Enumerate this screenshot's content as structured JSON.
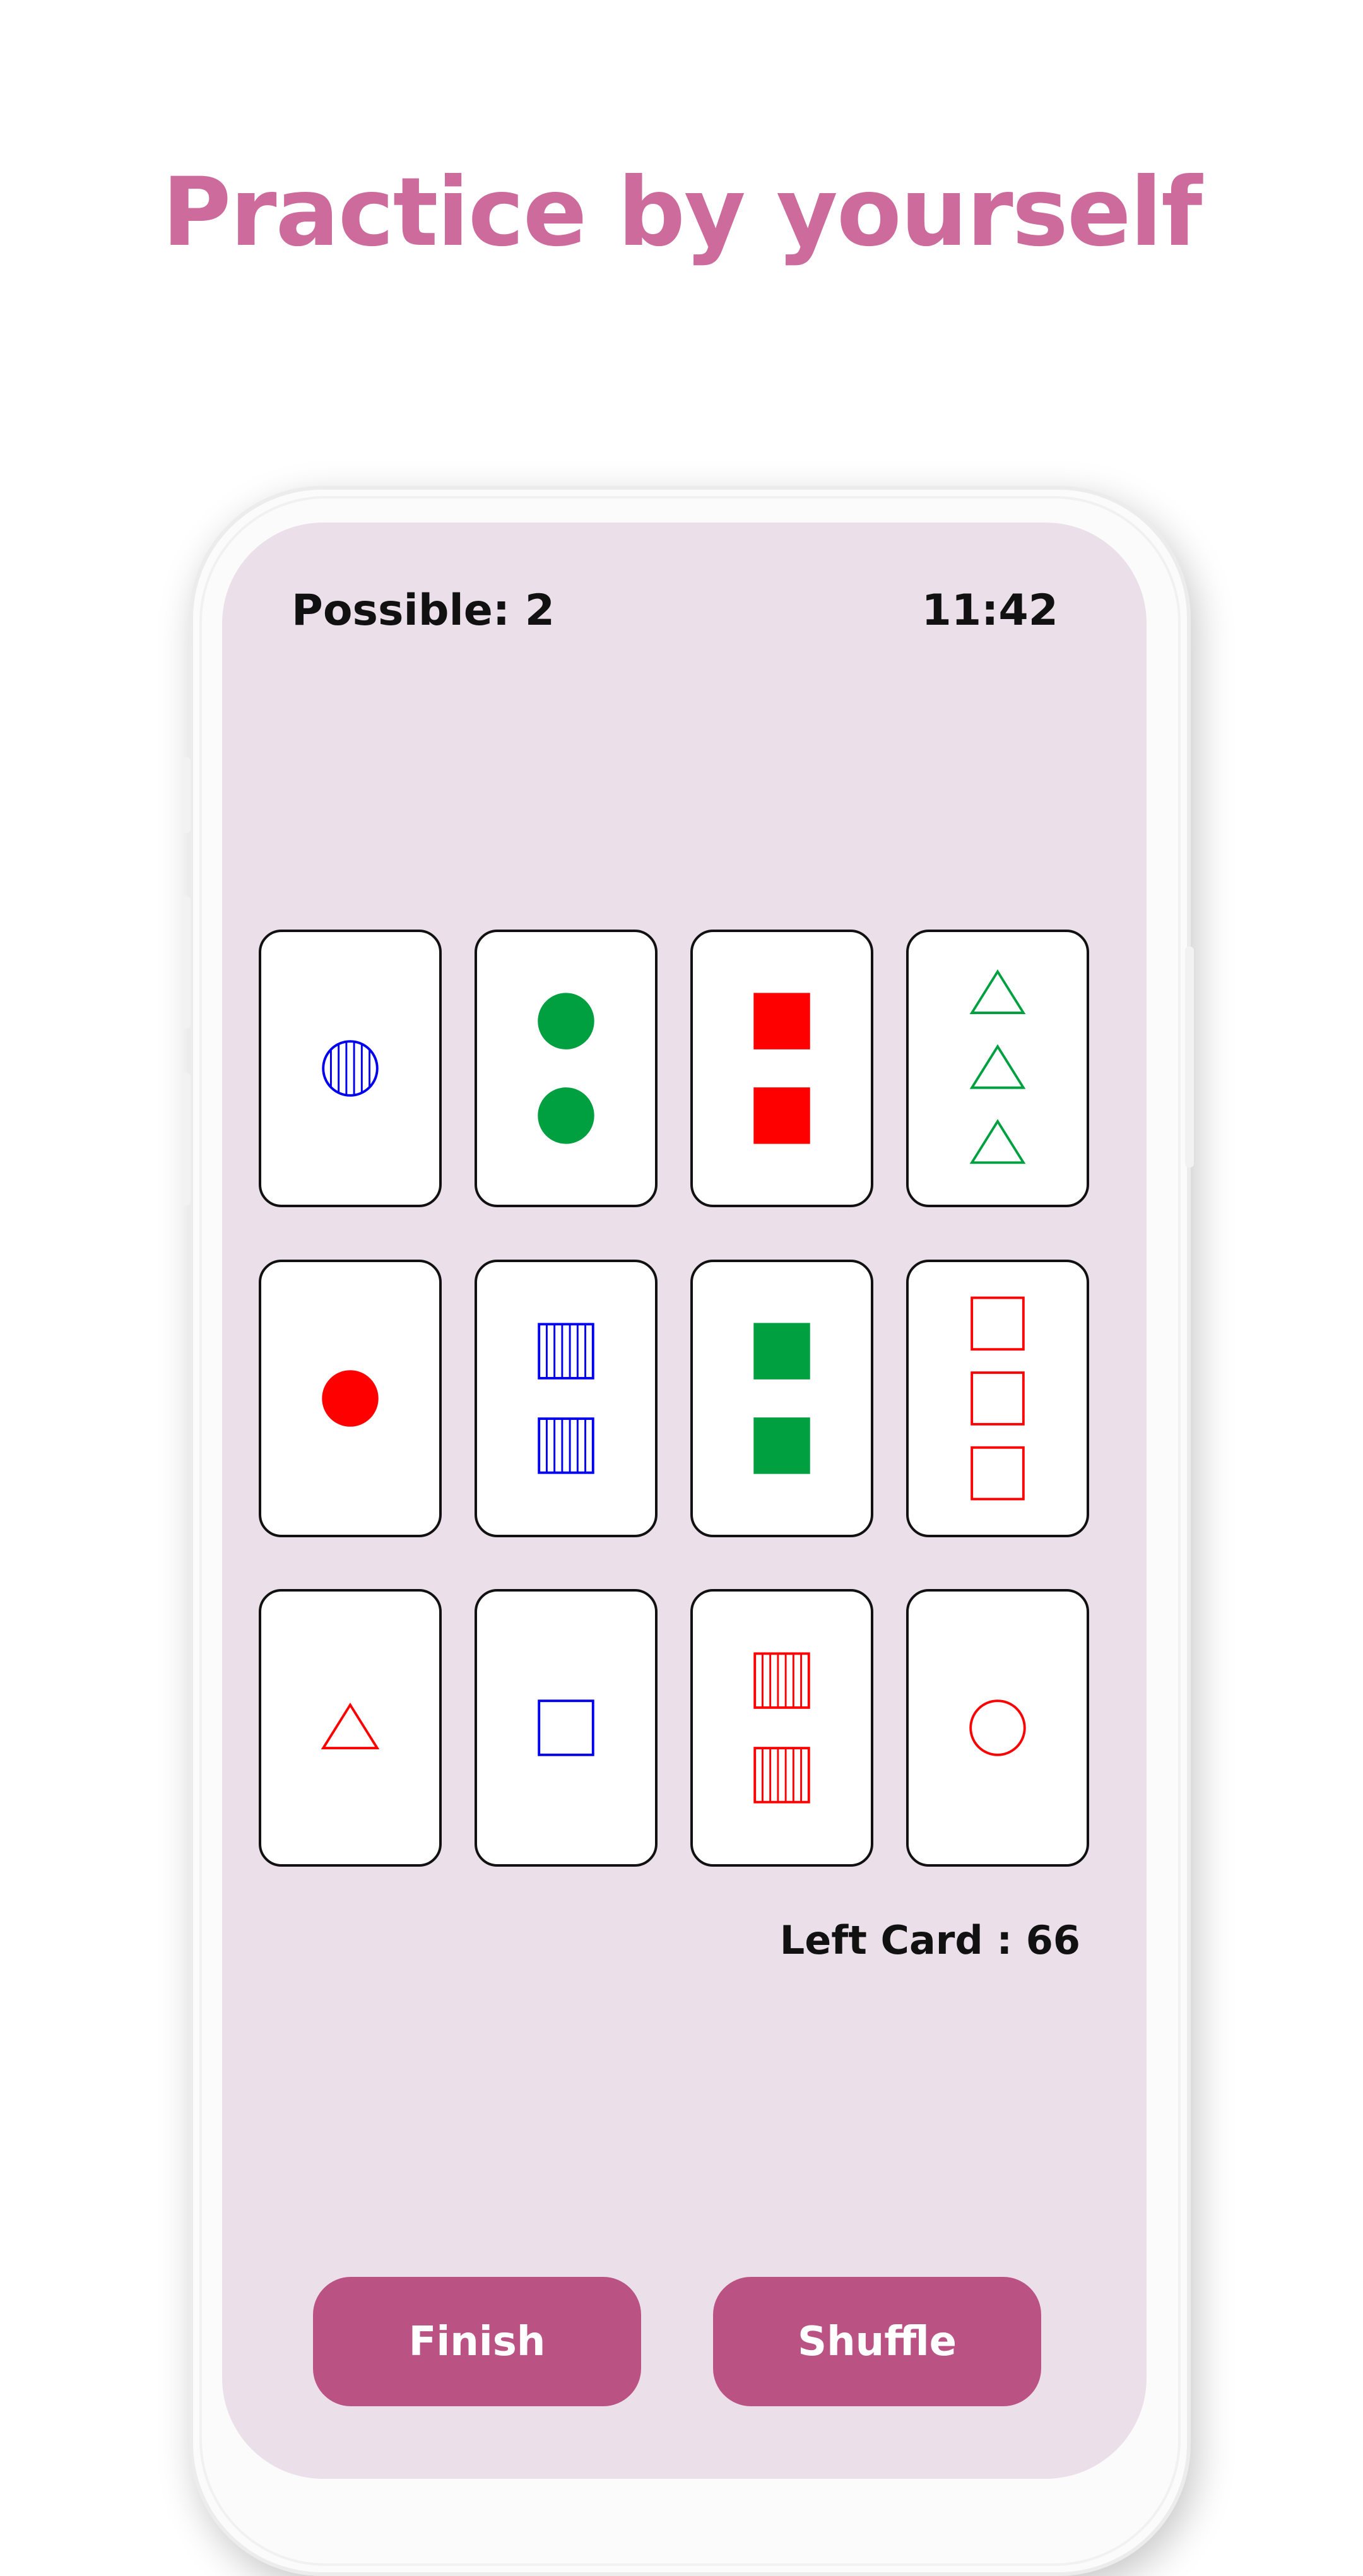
{
  "headline": "Practice by yourself",
  "status": {
    "possible": "Possible: 2",
    "clock": "11:42"
  },
  "colors": {
    "red": "#ff0000",
    "green": "#00a040",
    "blue": "#0000ee",
    "accent": "#ba5384",
    "headline": "#cc6b9c",
    "screen_bg": "#ebe0e9"
  },
  "cards": [
    {
      "count": 1,
      "shape": "circle",
      "fill": "striped",
      "color": "blue"
    },
    {
      "count": 2,
      "shape": "circle",
      "fill": "solid",
      "color": "green"
    },
    {
      "count": 2,
      "shape": "square",
      "fill": "solid",
      "color": "red"
    },
    {
      "count": 3,
      "shape": "triangle",
      "fill": "outline",
      "color": "green"
    },
    {
      "count": 1,
      "shape": "circle",
      "fill": "solid",
      "color": "red"
    },
    {
      "count": 2,
      "shape": "square",
      "fill": "striped",
      "color": "blue"
    },
    {
      "count": 2,
      "shape": "square",
      "fill": "solid",
      "color": "green"
    },
    {
      "count": 3,
      "shape": "square",
      "fill": "outline",
      "color": "red"
    },
    {
      "count": 1,
      "shape": "triangle",
      "fill": "outline",
      "color": "red"
    },
    {
      "count": 1,
      "shape": "square",
      "fill": "outline",
      "color": "blue"
    },
    {
      "count": 2,
      "shape": "square",
      "fill": "striped",
      "color": "red"
    },
    {
      "count": 1,
      "shape": "circle",
      "fill": "outline",
      "color": "red"
    }
  ],
  "left_card": "Left Card : 66",
  "buttons": {
    "finish": "Finish",
    "shuffle": "Shuffle"
  }
}
